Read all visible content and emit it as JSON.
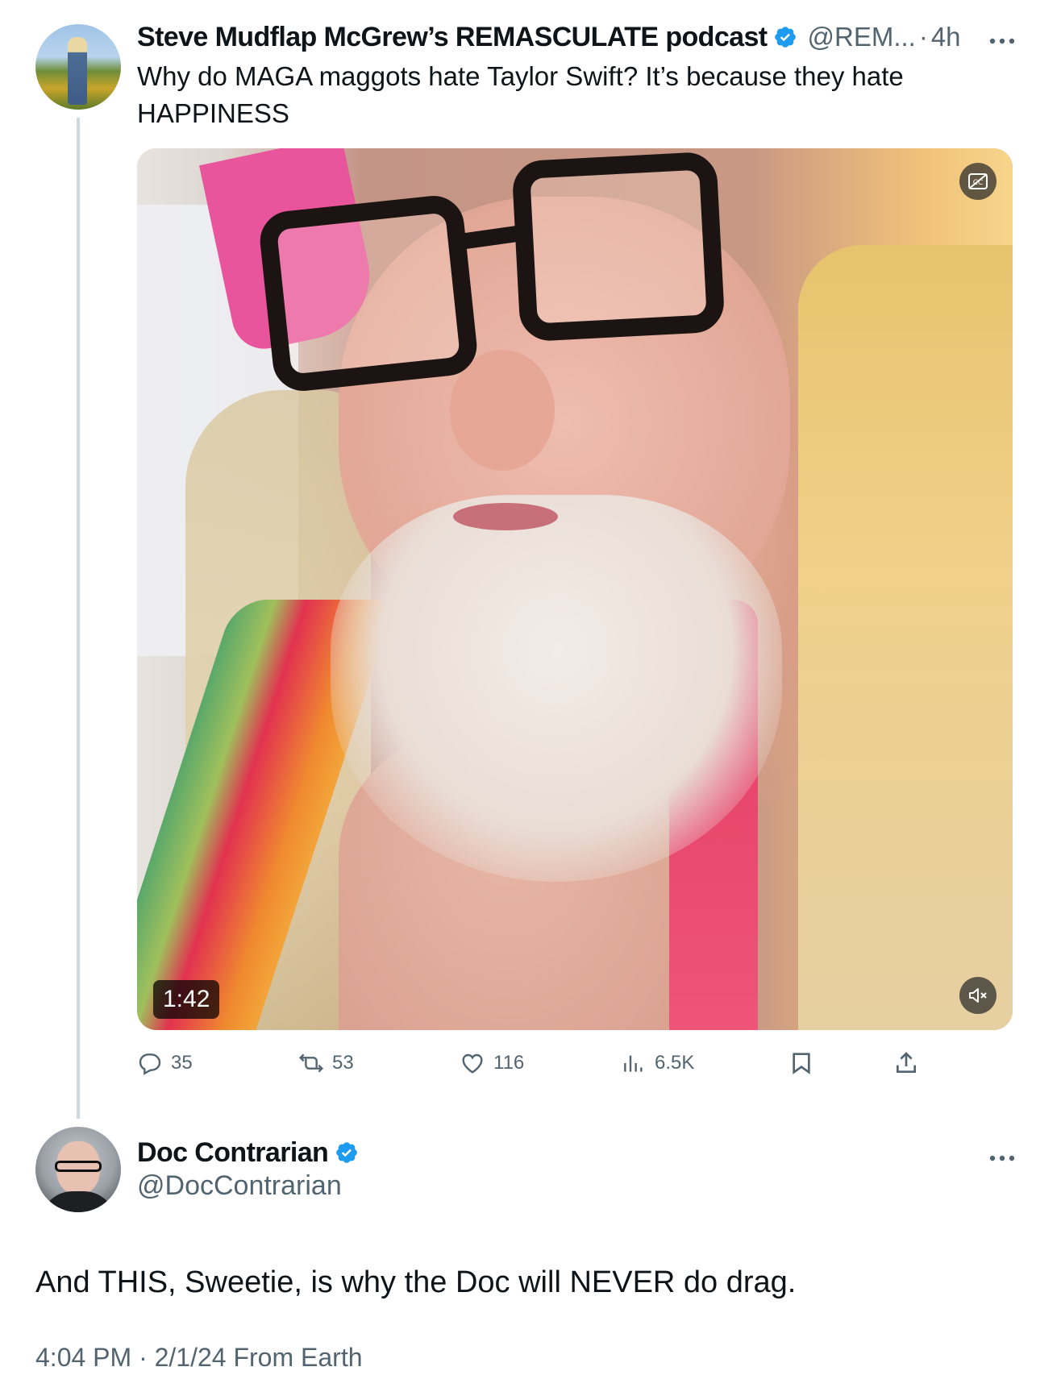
{
  "parent_tweet": {
    "display_name": "Steve Mudflap McGrew’s REMASCULATE podcast",
    "handle": "@REM...",
    "time": "4h",
    "text": "Why do MAGA maggots hate Taylor Swift?  It’s because they hate HAPPINESS",
    "video": {
      "duration": "1:42",
      "muted": true
    },
    "stats": {
      "replies": "35",
      "reposts": "53",
      "likes": "116",
      "views": "6.5K"
    }
  },
  "main_tweet": {
    "display_name": "Doc Contrarian",
    "handle": "@DocContrarian",
    "text": "And THIS, Sweetie, is why the Doc will NEVER do drag.",
    "time": "4:04 PM",
    "date": "2/1/24",
    "source": "From Earth"
  },
  "separator": "·",
  "colors": {
    "verified_blue": "#1d9bf0",
    "muted_text": "#536471",
    "thread_line": "#cfd9de"
  },
  "icons": [
    "verified-badge-icon",
    "more-icon",
    "reply-icon",
    "repost-icon",
    "like-icon",
    "views-icon",
    "bookmark-icon",
    "share-icon",
    "captions-icon",
    "mute-icon"
  ]
}
